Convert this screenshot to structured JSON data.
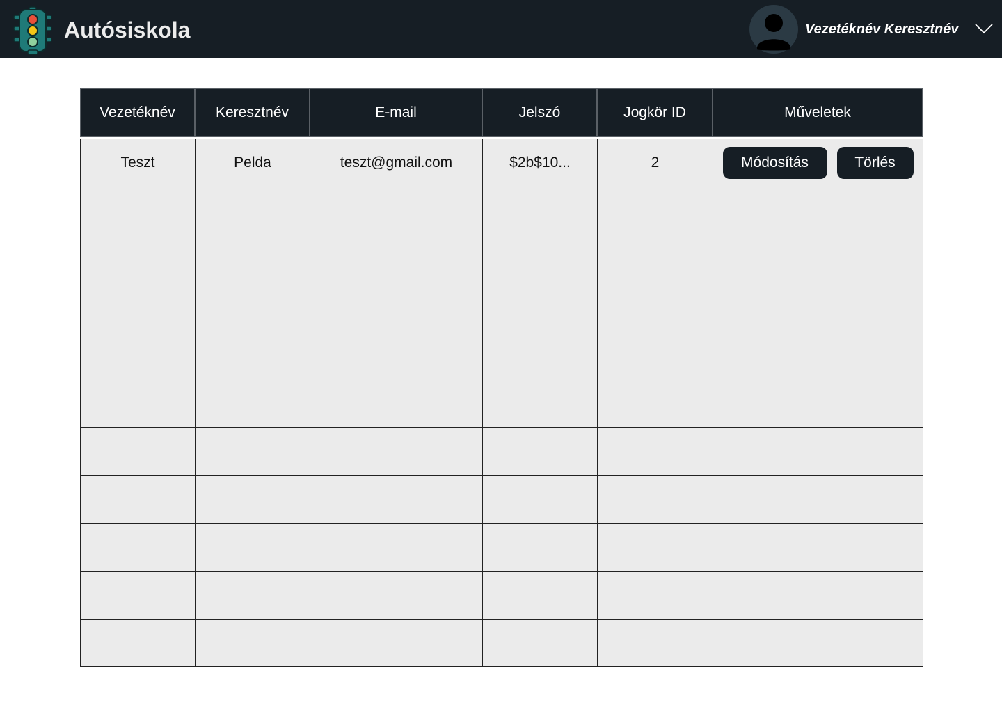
{
  "header": {
    "app_title": "Autósiskola",
    "logo_icon": "traffic-light-icon",
    "avatar_icon": "user-avatar-icon",
    "user_name": "Vezetéknév Keresztnév",
    "dropdown_icon": "chevron-down-icon",
    "background": "#161e25"
  },
  "table": {
    "columns": [
      "Vezetéknév",
      "Keresztnév",
      "E-mail",
      "Jelszó",
      "Jogkör ID",
      "Műveletek"
    ],
    "rows": [
      {
        "lastname": "Teszt",
        "firstname": "Pelda",
        "email": "teszt@gmail.com",
        "password": "$2b$10...",
        "role_id": "2",
        "actions": [
          "Módosítás",
          "Törlés"
        ]
      },
      {
        "lastname": "",
        "firstname": "",
        "email": "",
        "password": "",
        "role_id": "",
        "actions": []
      },
      {
        "lastname": "",
        "firstname": "",
        "email": "",
        "password": "",
        "role_id": "",
        "actions": []
      },
      {
        "lastname": "",
        "firstname": "",
        "email": "",
        "password": "",
        "role_id": "",
        "actions": []
      },
      {
        "lastname": "",
        "firstname": "",
        "email": "",
        "password": "",
        "role_id": "",
        "actions": []
      },
      {
        "lastname": "",
        "firstname": "",
        "email": "",
        "password": "",
        "role_id": "",
        "actions": []
      },
      {
        "lastname": "",
        "firstname": "",
        "email": "",
        "password": "",
        "role_id": "",
        "actions": []
      },
      {
        "lastname": "",
        "firstname": "",
        "email": "",
        "password": "",
        "role_id": "",
        "actions": []
      },
      {
        "lastname": "",
        "firstname": "",
        "email": "",
        "password": "",
        "role_id": "",
        "actions": []
      },
      {
        "lastname": "",
        "firstname": "",
        "email": "",
        "password": "",
        "role_id": "",
        "actions": []
      },
      {
        "lastname": "",
        "firstname": "",
        "email": "",
        "password": "",
        "role_id": "",
        "actions": []
      }
    ]
  },
  "colors": {
    "dark": "#161e25",
    "cell_bg": "#ebebeb",
    "light_red": "#e8503a",
    "light_yellow": "#f5c518",
    "light_green": "#8fd19e",
    "housing": "#1f7a78"
  }
}
